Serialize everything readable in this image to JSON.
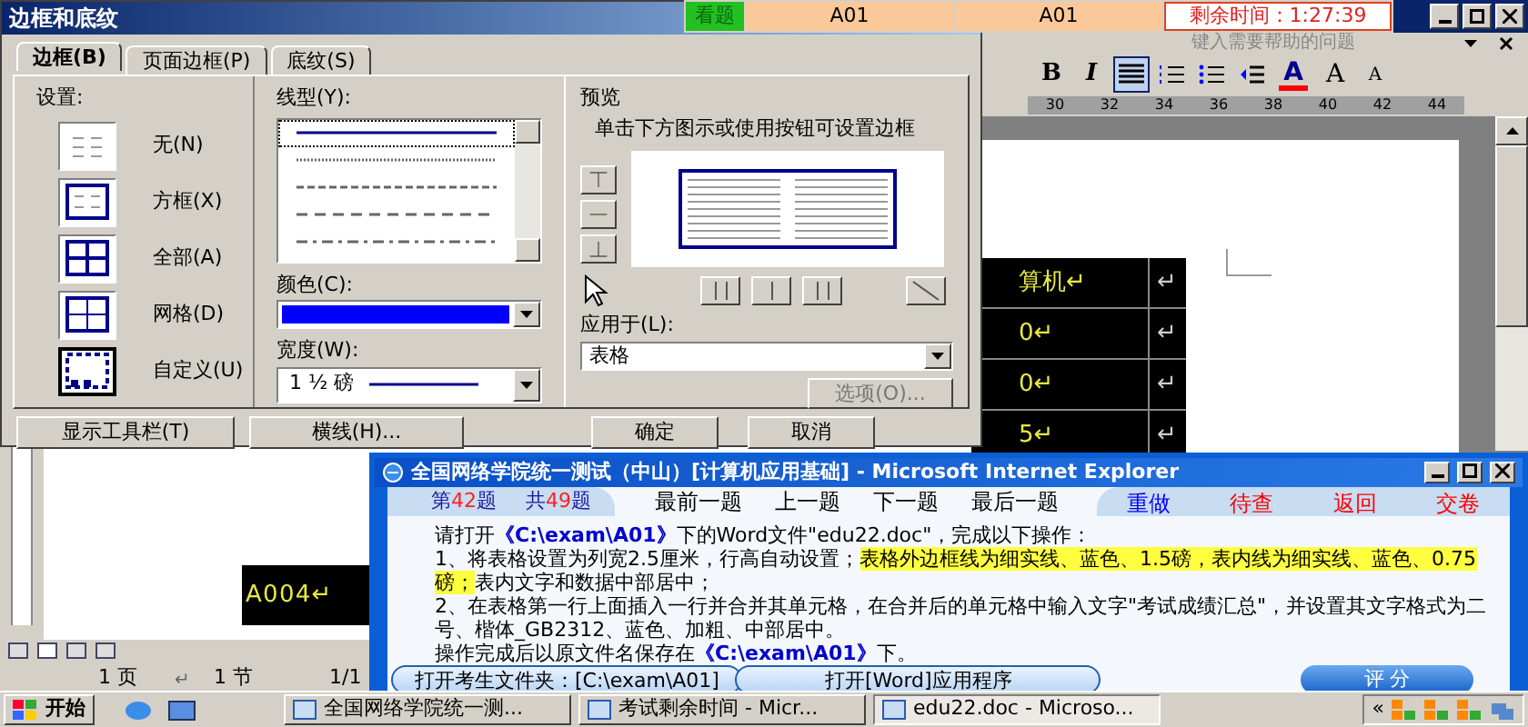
{
  "word": {
    "help_placeholder": "键入需要帮助的问题",
    "toolbar": [
      {
        "kind": "text",
        "label": "B",
        "selected": false
      },
      {
        "kind": "text",
        "label": "I",
        "selected": false
      },
      {
        "kind": "align",
        "selected": true
      },
      {
        "kind": "numbered",
        "selected": false
      },
      {
        "kind": "bullets",
        "selected": false
      },
      {
        "kind": "indent",
        "selected": false
      },
      {
        "kind": "fontcolor",
        "label": "A",
        "selected": false
      },
      {
        "kind": "grow",
        "label": "A",
        "selected": false
      },
      {
        "kind": "shrink",
        "label": "A",
        "selected": false
      }
    ],
    "ruler_numbers": [
      "30",
      "32",
      "34",
      "36",
      "38",
      "40",
      "42",
      "44"
    ],
    "right_table": [
      {
        "cells": [
          "算机↵",
          "↵"
        ]
      },
      {
        "cells": [
          "0↵",
          "↵"
        ]
      },
      {
        "cells": [
          "0↵",
          "↵"
        ]
      },
      {
        "cells": [
          "5↵",
          "↵"
        ]
      }
    ],
    "left_table_cell": "A004↵",
    "paragraph_mark": "↵",
    "status": [
      "1 页",
      "1 节",
      "1/1"
    ]
  },
  "timer_bar": {
    "view_button": "看题",
    "cells": [
      "A01",
      "A01"
    ],
    "remaining": "剩余时间：1:27:39"
  },
  "dialog": {
    "title": "边框和底纹",
    "tabs": [
      {
        "label": "边框(B)",
        "selected": true
      },
      {
        "label": "页面边框(P)",
        "selected": false
      },
      {
        "label": "底纹(S)",
        "selected": false
      }
    ],
    "settings_label": "设置:",
    "settings": [
      {
        "kind": "none",
        "label": "无(N)",
        "selected": false
      },
      {
        "kind": "box",
        "label": "方框(X)",
        "selected": false
      },
      {
        "kind": "all",
        "label": "全部(A)",
        "selected": false
      },
      {
        "kind": "grid",
        "label": "网格(D)",
        "selected": false
      },
      {
        "kind": "custom",
        "label": "自定义(U)",
        "selected": true
      }
    ],
    "line_style_label": "线型(Y):",
    "line_styles": [
      {
        "kind": "solid",
        "selected": true
      },
      {
        "kind": "dotted",
        "selected": false
      },
      {
        "kind": "dashed",
        "selected": false
      },
      {
        "kind": "longdash",
        "selected": false
      },
      {
        "kind": "dashdot",
        "selected": false
      }
    ],
    "color_label": "颜色(C):",
    "color": "#0000ff",
    "width_label": "宽度(W):",
    "width_value": "1 ½ 磅",
    "preview_label": "预览",
    "preview_hint": "单击下方图示或使用按钮可设置边框",
    "apply_label": "应用于(L):",
    "apply_value": "表格",
    "options_button": {
      "label": "选项(O)...",
      "disabled": true
    },
    "buttons": [
      "显示工具栏(T)",
      "横线(H)...",
      "确定",
      "取消"
    ]
  },
  "exam": {
    "title": "全国网络学院统一测试（中山）[计算机应用基础] - Microsoft Internet Explorer",
    "counters": [
      [
        {
          "kind": "plain",
          "text": "第"
        },
        {
          "kind": "number",
          "text": "42"
        },
        {
          "kind": "plain",
          "text": "题"
        }
      ],
      [
        {
          "kind": "plain",
          "text": "共"
        },
        {
          "kind": "number",
          "text": "49"
        },
        {
          "kind": "plain",
          "text": "题"
        }
      ]
    ],
    "nav": [
      "最前一题",
      "上一题",
      "下一题",
      "最后一题"
    ],
    "actions": [
      {
        "label": "重做",
        "color": "#0000ff"
      },
      {
        "label": "待查",
        "color": "#ff0000"
      },
      {
        "label": "返回",
        "color": "#ff0000"
      },
      {
        "label": "交卷",
        "color": "#ff0000"
      }
    ],
    "paragraphs": [
      [
        {
          "kind": "plain",
          "text": "请打开"
        },
        {
          "kind": "path",
          "text": "《C:\\exam\\A01》"
        },
        {
          "kind": "plain",
          "text": "下的Word文件\"edu22.doc\"，完成以下操作："
        }
      ],
      [
        {
          "kind": "plain",
          "text": "1、将表格设置为列宽2.5厘米，行高自动设置；"
        },
        {
          "kind": "highlight",
          "text": "表格外边框线为细实线、蓝色、1.5磅，表内线为细实线、蓝色、0.75磅；"
        },
        {
          "kind": "plain",
          "text": "表内文字和数据中部居中；"
        }
      ],
      [
        {
          "kind": "plain",
          "text": "2、在表格第一行上面插入一行并合并其单元格，在合并后的单元格中输入文字\"考试成绩汇总\"，并设置其文字格式为二号、楷体_GB2312、蓝色、加粗、中部居中。"
        }
      ],
      [
        {
          "kind": "plain",
          "text": "操作完成后以原文件名保存在"
        },
        {
          "kind": "path",
          "text": "《C:\\exam\\A01》"
        },
        {
          "kind": "plain",
          "text": "下。"
        }
      ]
    ],
    "buttons": [
      "打开考生文件夹：[C:\\exam\\A01]",
      "打开[Word]应用程序"
    ],
    "score_button": "评 分"
  },
  "taskbar": {
    "start": "开始",
    "tasks": [
      {
        "label": "全国网络学院统一测...",
        "selected": false
      },
      {
        "label": "考试剩余时间 - Micr...",
        "selected": false
      },
      {
        "label": "edu22.doc - Microso...",
        "selected": true
      }
    ],
    "tray_arrow": "«"
  }
}
